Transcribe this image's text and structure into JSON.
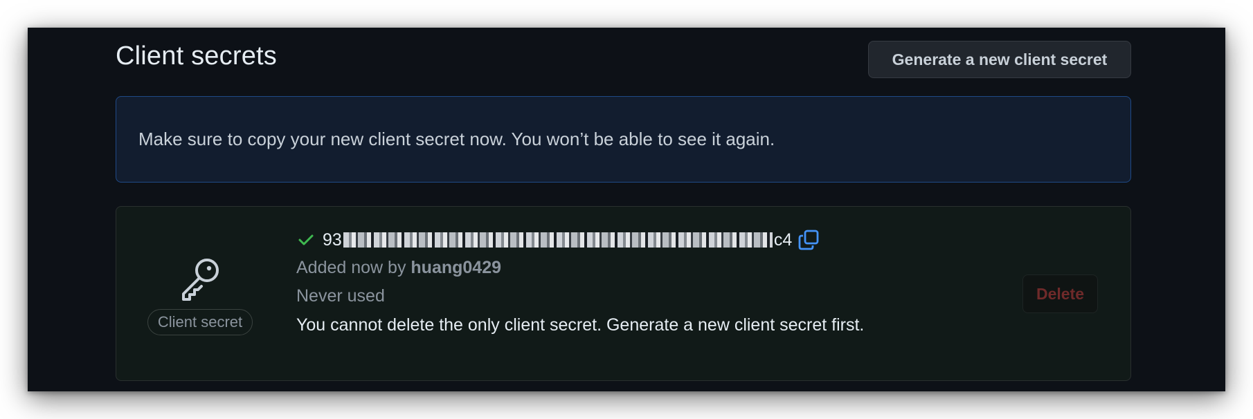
{
  "section": {
    "title": "Client secrets",
    "generate_button_label": "Generate a new client secret"
  },
  "flash": {
    "message": "Make sure to copy your new client secret now. You won’t be able to see it again."
  },
  "secret": {
    "icon": "key-icon",
    "type_label": "Client secret",
    "value_prefix": "93",
    "value_suffix": "c4",
    "status_icon": "check-icon",
    "copy_icon": "copy-icon",
    "added_prefix": "Added now by",
    "added_by": "huang0429",
    "usage": "Never used",
    "warning": "You cannot delete the only client secret. Generate a new client secret first.",
    "delete_label": "Delete"
  },
  "colors": {
    "background": "#0d1117",
    "flash_border": "#1f4a87",
    "check": "#3fb950",
    "copy": "#4493f8",
    "delete_disabled": "#6f2a2a"
  }
}
